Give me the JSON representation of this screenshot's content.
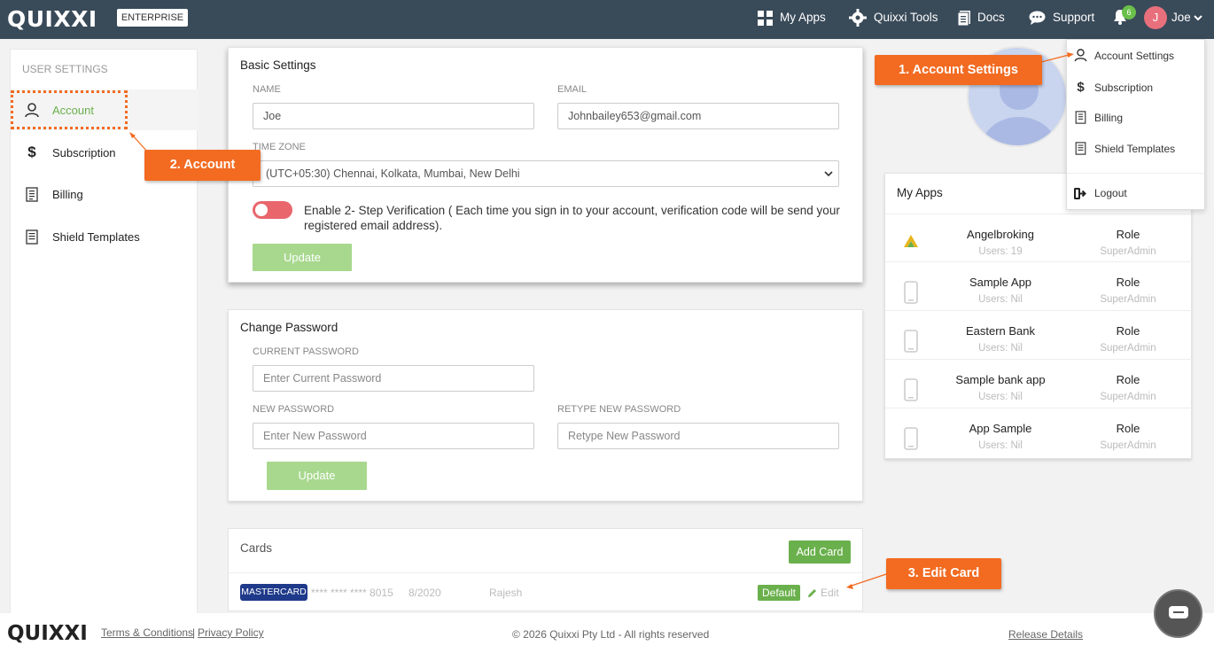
{
  "header": {
    "logo": "QUIXXI",
    "edition": "ENTERPRISE",
    "nav": [
      "My Apps",
      "Quixxi Tools",
      "Docs",
      "Support"
    ],
    "notification_count": "6",
    "user_initial": "J",
    "user_name": "Joe"
  },
  "sidebar": {
    "title": "USER SETTINGS",
    "items": [
      {
        "label": "Account",
        "icon": "person-icon"
      },
      {
        "label": "Subscription",
        "icon": "dollar-icon"
      },
      {
        "label": "Billing",
        "icon": "receipt-icon"
      },
      {
        "label": "Shield Templates",
        "icon": "document-icon"
      }
    ]
  },
  "basic_settings": {
    "title": "Basic Settings",
    "name_label": "NAME",
    "name_value": "Joe",
    "email_label": "EMAIL",
    "email_value": "Johnbailey653@gmail.com",
    "timezone_label": "TIME ZONE",
    "timezone_value": "(UTC+05:30) Chennai, Kolkata, Mumbai, New Delhi",
    "twofa_text": "Enable 2- Step Verification ( Each time you sign in to your account, verification code will be send your registered email address).",
    "update_label": "Update"
  },
  "change_password": {
    "title": "Change Password",
    "current_label": "CURRENT PASSWORD",
    "current_placeholder": "Enter Current Password",
    "new_label": "NEW PASSWORD",
    "new_placeholder": "Enter New Password",
    "retype_label": "RETYPE NEW PASSWORD",
    "retype_placeholder": "Retype New Password",
    "update_label": "Update"
  },
  "cards": {
    "title": "Cards",
    "add_label": "Add Card",
    "card_type": "MASTERCARD",
    "card_number": "**** **** **** 8015",
    "card_expiry": "8/2020",
    "card_holder": "Rajesh",
    "default_label": "Default",
    "edit_label": "Edit"
  },
  "my_apps": {
    "title": "My Apps",
    "apps": [
      {
        "name": "Angelbroking",
        "users": "Users: 19",
        "role_label": "Role",
        "role": "SuperAdmin"
      },
      {
        "name": "Sample App",
        "users": "Users: Nil",
        "role_label": "Role",
        "role": "SuperAdmin"
      },
      {
        "name": "Eastern Bank",
        "users": "Users: Nil",
        "role_label": "Role",
        "role": "SuperAdmin"
      },
      {
        "name": "Sample bank app",
        "users": "Users: Nil",
        "role_label": "Role",
        "role": "SuperAdmin"
      },
      {
        "name": "App Sample",
        "users": "Users: Nil",
        "role_label": "Role",
        "role": "SuperAdmin"
      }
    ]
  },
  "user_menu": {
    "items": [
      "Account Settings",
      "Subscription",
      "Billing",
      "Shield Templates"
    ],
    "logout": "Logout"
  },
  "callouts": {
    "one": "1. Account Settings",
    "two": "2. Account",
    "three": "3. Edit Card"
  },
  "footer": {
    "logo": "QUIXXI",
    "terms": "Terms & Conditions",
    "separator": "|",
    "privacy": "Privacy Policy",
    "copyright": "© 2026 Quixxi Pty Ltd - All rights reserved",
    "release": "Release Details"
  },
  "colors": {
    "nav_bg": "#394a59",
    "accent_green": "#6ab04c",
    "callout_orange": "#f26b21",
    "toggle_red": "#e8666c"
  }
}
